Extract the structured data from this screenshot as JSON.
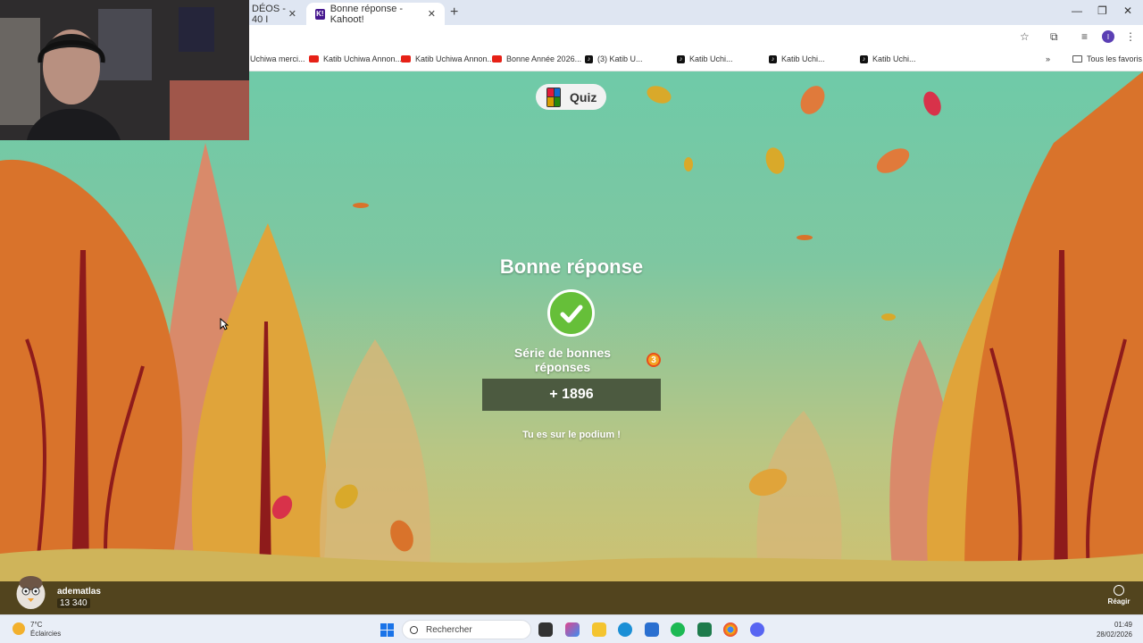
{
  "browser": {
    "tabs": [
      {
        "title": "DÉOS - 40 I",
        "active": false
      },
      {
        "title": "Bonne réponse - Kahoot!",
        "active": true
      }
    ],
    "kahoot_favicon": "K!",
    "profile_initial": "I",
    "bookmarks": [
      {
        "label": "Uchiwa merci...",
        "icon": "none"
      },
      {
        "label": "Katib Uchiwa Annon...",
        "icon": "youtube-icon"
      },
      {
        "label": "Katib Uchiwa Annon...",
        "icon": "youtube-icon"
      },
      {
        "label": "Bonne Année 2026...",
        "icon": "youtube-icon"
      },
      {
        "label": "(3)  Katib U...",
        "icon": "tiktok-icon"
      },
      {
        "label": "Katib Uchi...",
        "icon": "tiktok-icon"
      },
      {
        "label": "Katib Uchi...",
        "icon": "tiktok-icon"
      },
      {
        "label": "Katib Uchi...",
        "icon": "tiktok-icon"
      }
    ],
    "all_bookmarks_label": "Tous les favoris"
  },
  "game": {
    "quiz_label": "Quiz",
    "result_title": "Bonne réponse",
    "streak_label": "Série de bonnes réponses",
    "streak_count": "3",
    "points": "+ 1896",
    "podium_message": "Tu es sur le podium !",
    "player": {
      "name": "adematlas",
      "score": "13 340"
    },
    "react_label": "Réagir",
    "colors": {
      "correct": "#66bf39",
      "points_bg": "#4c5a40",
      "sky": "#6fcaa8"
    }
  },
  "taskbar": {
    "weather_temp": "7°C",
    "weather_desc": "Éclaircies",
    "search_placeholder": "Rechercher",
    "time": "01:49",
    "date": "28/02/2026"
  }
}
